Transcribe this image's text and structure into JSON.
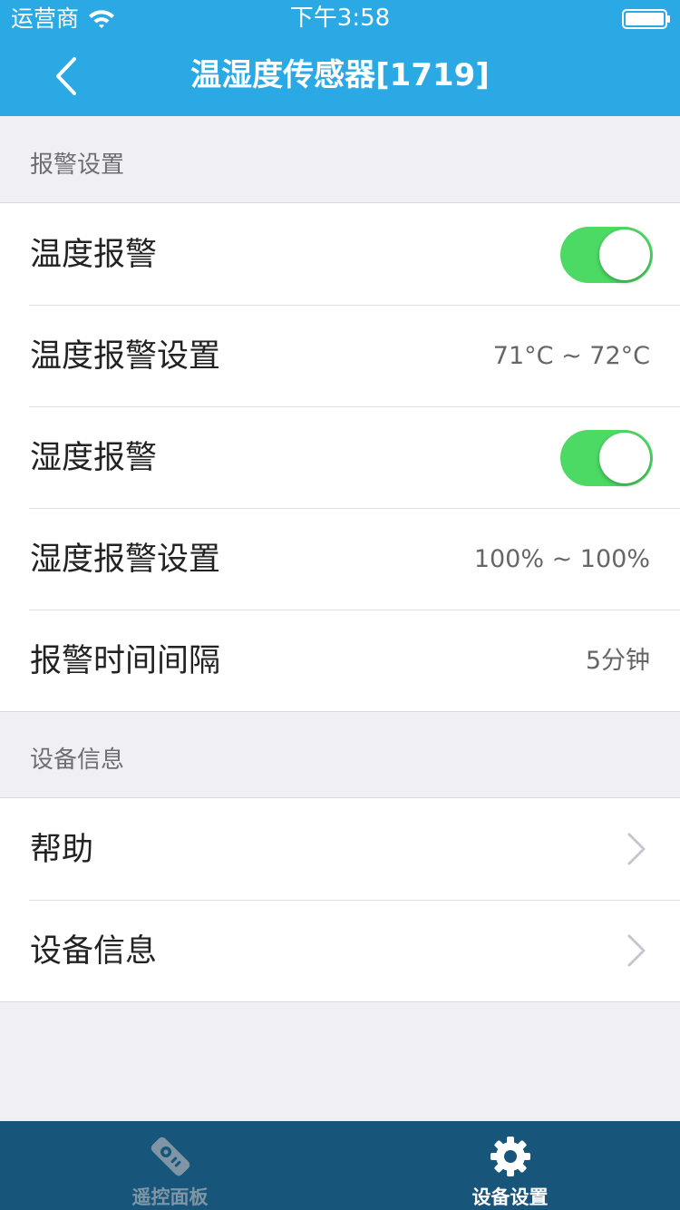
{
  "status_bar": {
    "carrier": "运营商",
    "time": "下午3:58",
    "wifi_icon": "wifi-icon",
    "battery_icon": "battery-icon"
  },
  "nav": {
    "back_icon": "chevron-left-icon",
    "title": "温湿度传感器[1719]"
  },
  "alarm_section": {
    "header": "报警设置",
    "rows": [
      {
        "label": "温度报警",
        "toggle_on": true
      },
      {
        "label": "温度报警设置",
        "value": "71°C ~ 72°C"
      },
      {
        "label": "湿度报警",
        "toggle_on": true
      },
      {
        "label": "湿度报警设置",
        "value": "100% ~ 100%"
      },
      {
        "label": "报警时间间隔",
        "value": "5分钟"
      }
    ]
  },
  "device_section": {
    "header": "设备信息",
    "rows": [
      {
        "label": "帮助",
        "icon": "chevron-right-icon"
      },
      {
        "label": "设备信息",
        "icon": "chevron-right-icon"
      }
    ]
  },
  "tab_bar": {
    "tabs": [
      {
        "label": "遥控面板",
        "icon": "remote-control-icon",
        "active": false
      },
      {
        "label": "设备设置",
        "icon": "gear-icon",
        "active": true
      }
    ]
  },
  "colors": {
    "header": "#2aa9e5",
    "toggle_on": "#4cd964",
    "tab_bar": "#17557a",
    "tab_inactive": "#7f95a4",
    "tab_active": "#ffffff"
  }
}
